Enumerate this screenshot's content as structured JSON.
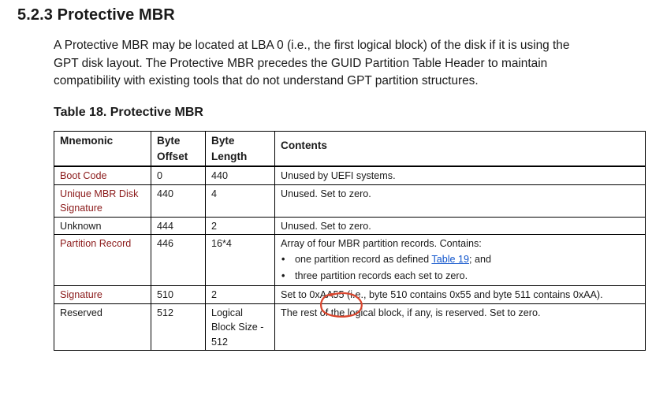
{
  "section": {
    "heading": "5.2.3 Protective MBR",
    "intro_lines": [
      "A Protective MBR may be located at LBA 0 (i.e., the first logical block) of the disk if it is using the",
      "GPT disk layout. The Protective MBR precedes the GUID Partition Table Header to maintain",
      "compatibility with existing tools that do not understand GPT partition structures."
    ]
  },
  "table": {
    "caption": "Table 18. Protective MBR",
    "headers": {
      "mnemonic": "Mnemonic",
      "byte_offset": "Byte Offset",
      "byte_length": "Byte Length",
      "contents": "Contents"
    },
    "rows": [
      {
        "mnemonic": "Boot Code",
        "offset": "0",
        "length": "440",
        "contents": "Unused by UEFI systems."
      },
      {
        "mnemonic": "Unique MBR Disk Signature",
        "offset": "440",
        "length": "4",
        "contents": "Unused. Set to zero."
      },
      {
        "mnemonic": "Unknown",
        "offset": "444",
        "length": "2",
        "contents": "Unused. Set to zero."
      },
      {
        "mnemonic": "Partition Record",
        "offset": "446",
        "length": "16*4",
        "contents": "Array of four MBR partition records. Contains:",
        "bullets": {
          "b1_prefix": "one partition record as defined ",
          "b1_link": "Table 19",
          "b1_suffix": "; and",
          "b2": "three partition records each set to zero."
        }
      },
      {
        "mnemonic": "Signature",
        "offset": "510",
        "length": "2",
        "contents": "Set to 0xAA55 (i.e., byte 510 contains 0x55 and byte 511 contains 0xAA)."
      },
      {
        "mnemonic": "Reserved",
        "offset": "512",
        "length": "Logical Block Size - 512",
        "contents": "The rest of the logical block, if any, is reserved. Set to zero."
      }
    ]
  },
  "annotation": {
    "marker": "hand-drawn-circle",
    "color": "#d9462e"
  },
  "colors": {
    "mnemonic_text": "#8b1a1a",
    "link": "#1155cc",
    "body_text": "#1a1a1a"
  }
}
